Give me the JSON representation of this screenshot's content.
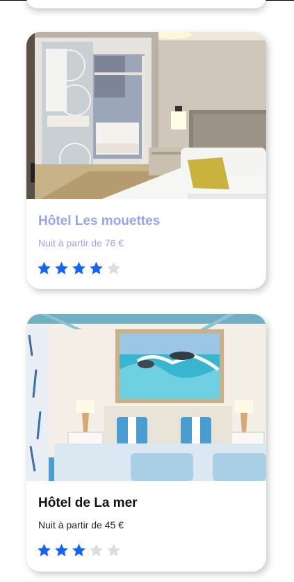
{
  "colors": {
    "star_filled": "#1665f2",
    "star_empty": "#dcdcdc",
    "title_faded": "#9aa3f2",
    "title_dark": "#111111"
  },
  "hotels": [
    {
      "name": "Hôtel Les mouettes",
      "price": "Nuit à partir de 76 €",
      "rating": 4,
      "max_rating": 5,
      "photo": "hotel-room-mirror-wardrobe-photo"
    },
    {
      "name": "Hôtel de La mer",
      "price": "Nuit à partir de 45 €",
      "rating": 3,
      "max_rating": 5,
      "photo": "hotel-room-sea-painting-photo"
    }
  ]
}
